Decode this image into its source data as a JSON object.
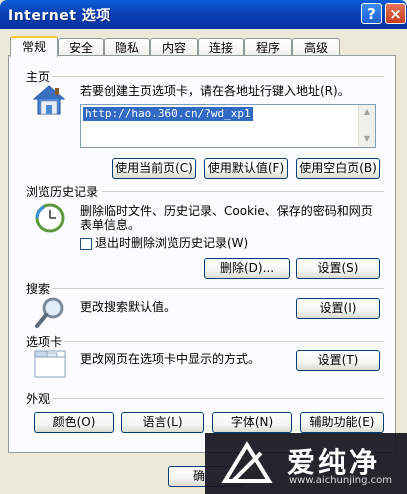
{
  "window": {
    "title": "Internet 选项",
    "help": "?",
    "close": "×"
  },
  "tabs": [
    "常规",
    "安全",
    "隐私",
    "内容",
    "连接",
    "程序",
    "高级"
  ],
  "home": {
    "section": "主页",
    "instruction": "若要创建主页选项卡，请在各地址行键入地址(R)。",
    "url": "http://hao.360.cn/?wd_xp1",
    "buttons": {
      "current": "使用当前页(C)",
      "default": "使用默认值(F)",
      "blank": "使用空白页(B)"
    }
  },
  "history": {
    "section": "浏览历史记录",
    "desc_line1": "删除临时文件、历史记录、Cookie、保存的密码和网页",
    "desc_line2": "表单信息。",
    "checkbox": "退出时删除浏览历史记录(W)",
    "buttons": {
      "delete": "删除(D)...",
      "settings": "设置(S)"
    }
  },
  "search": {
    "section": "搜索",
    "desc": "更改搜索默认值。",
    "button": "设置(I)"
  },
  "tabsec": {
    "section": "选项卡",
    "desc": "更改网页在选项卡中显示的方式。",
    "button": "设置(T)"
  },
  "appearance": {
    "section": "外观",
    "buttons": [
      "颜色(O)",
      "语言(L)",
      "字体(N)",
      "辅助功能(E)"
    ]
  },
  "footer": {
    "ok_partial": "确"
  },
  "watermark": {
    "cn": "爱纯净",
    "en": "www.aichunjing.com"
  }
}
